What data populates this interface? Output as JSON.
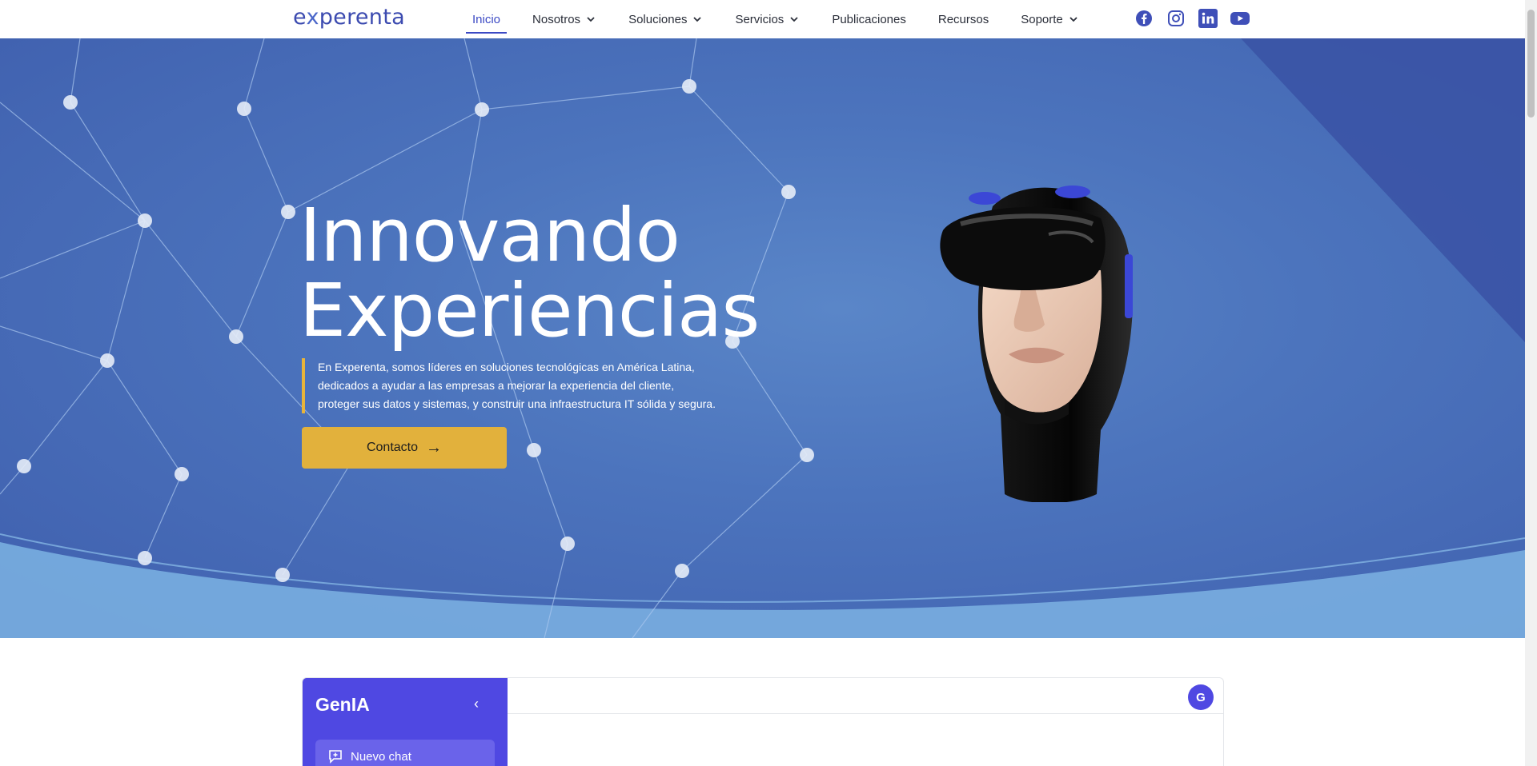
{
  "logo": {
    "prefix": "e",
    "x": "x",
    "rest": "perenta"
  },
  "nav": {
    "items": [
      {
        "label": "Inicio",
        "dropdown": false,
        "active": true
      },
      {
        "label": "Nosotros",
        "dropdown": true
      },
      {
        "label": "Soluciones",
        "dropdown": true
      },
      {
        "label": "Servicios",
        "dropdown": true
      },
      {
        "label": "Publicaciones",
        "dropdown": false
      },
      {
        "label": "Recursos",
        "dropdown": false
      },
      {
        "label": "Soporte",
        "dropdown": true
      }
    ],
    "socials": [
      "facebook-icon",
      "instagram-icon",
      "linkedin-icon",
      "youtube-icon"
    ]
  },
  "hero": {
    "title_line1": "Innovando",
    "title_line2": "Experiencias",
    "desc_line1": "En Experenta, somos líderes en soluciones tecnológicas en América Latina,",
    "desc_line2": "dedicados a ayudar a las empresas a mejorar la experiencia del cliente,",
    "desc_line3": "proteger sus datos y sistemas, y construir una infraestructura IT sólida y segura.",
    "cta_label": "Contacto"
  },
  "chat": {
    "title": "GenIA",
    "new_chat_label": "Nuevo chat",
    "avatar_initial": "G"
  },
  "colors": {
    "brand": "#3c4bb0",
    "accent": "#e2b13c",
    "hero_blue": "#4c74bd",
    "chat_purple": "#4f48e2"
  }
}
